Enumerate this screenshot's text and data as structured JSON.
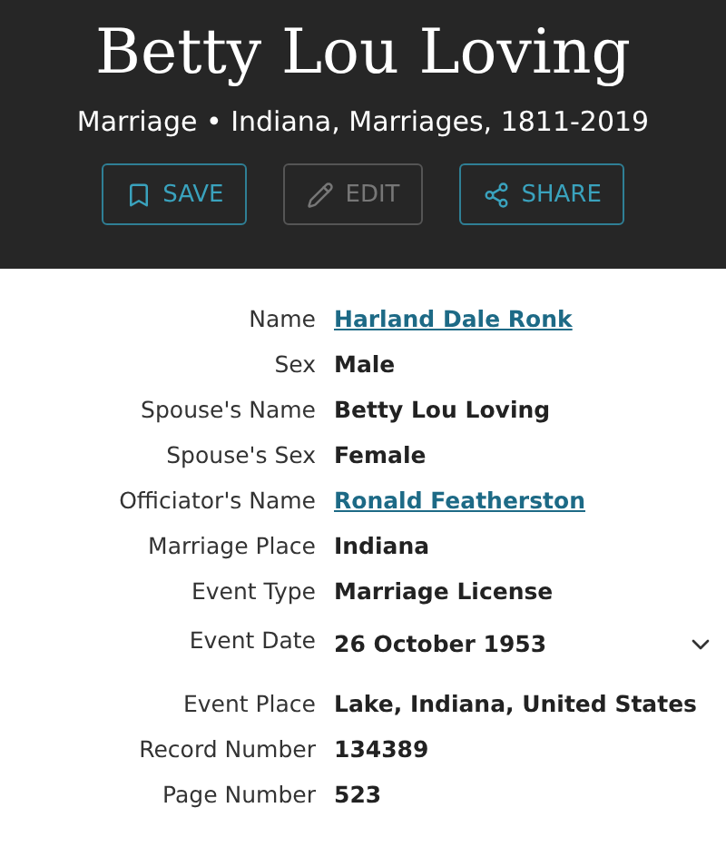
{
  "header": {
    "title": "Betty Lou Loving",
    "subtitle": "Marriage • Indiana, Marriages, 1811-2019"
  },
  "actions": [
    {
      "label": "SAVE",
      "kind": "save",
      "disabled": false
    },
    {
      "label": "EDIT",
      "kind": "edit",
      "disabled": true
    },
    {
      "label": "SHARE",
      "kind": "share",
      "disabled": false
    }
  ],
  "fields": [
    {
      "label": "Name",
      "value": "Harland Dale Ronk",
      "kind": "link"
    },
    {
      "label": "Sex",
      "value": "Male",
      "kind": "text"
    },
    {
      "label": "Spouse's Name",
      "value": "Betty Lou Loving",
      "kind": "text"
    },
    {
      "label": "Spouse's Sex",
      "value": "Female",
      "kind": "text"
    },
    {
      "label": "Officiator's Name",
      "value": "Ronald Featherston",
      "kind": "link"
    },
    {
      "label": "Marriage Place",
      "value": "Indiana",
      "kind": "text"
    },
    {
      "label": "Event Type",
      "value": "Marriage License",
      "kind": "text"
    },
    {
      "label": "Event Date",
      "value": "26 October 1953",
      "kind": "expandable",
      "expanded": false
    },
    {
      "label": "Event Place",
      "value": "Lake, Indiana, United States",
      "kind": "text"
    },
    {
      "label": "Record Number",
      "value": "134389",
      "kind": "text"
    },
    {
      "label": "Page Number",
      "value": "523",
      "kind": "text"
    }
  ]
}
